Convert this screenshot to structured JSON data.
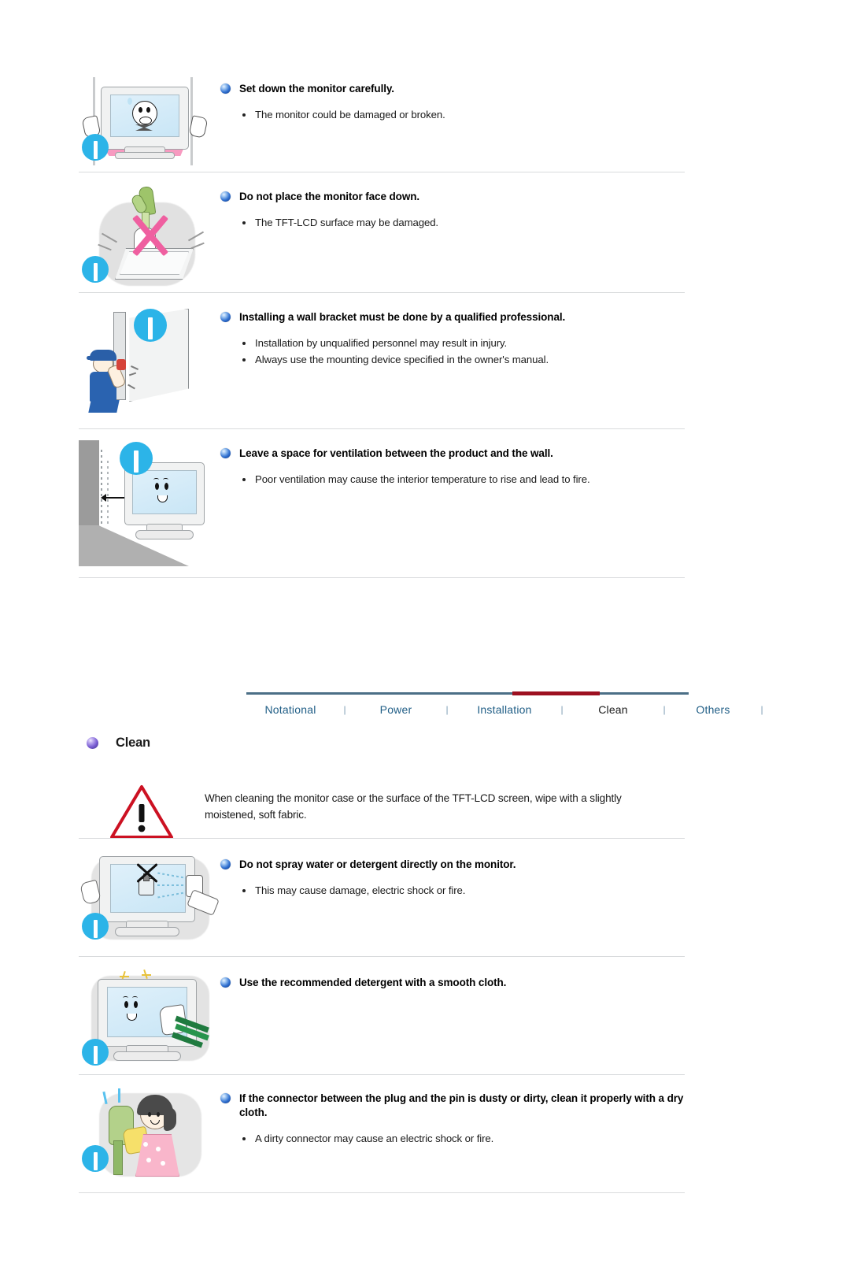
{
  "document": {
    "type": "monitor-safety-instructions-manual-page"
  },
  "sections": {
    "installation_items": [
      {
        "icon": "monitor-being-set-down-illustration",
        "badge": "blue-exclamation-icon",
        "title": "Set down the monitor carefully.",
        "bullets": [
          "The monitor could be damaged or broken."
        ]
      },
      {
        "icon": "monitor-face-down-crossed-out-illustration",
        "badge": "blue-exclamation-icon",
        "title": "Do not place the monitor face down.",
        "bullets": [
          "The TFT-LCD surface may be damaged."
        ]
      },
      {
        "icon": "technician-installing-wall-bracket-illustration",
        "badge": "blue-exclamation-icon",
        "title": "Installing a wall bracket must be done by a qualified professional.",
        "bullets": [
          "Installation by unqualified personnel may result in injury.",
          "Always use the mounting device specified in the owner's manual."
        ]
      },
      {
        "icon": "monitor-spaced-from-wall-illustration",
        "badge": "blue-exclamation-icon",
        "title": "Leave a space for ventilation between the product and the wall.",
        "bullets": [
          "Poor ventilation may cause the interior temperature to rise and lead to fire."
        ]
      }
    ]
  },
  "tabbar": {
    "tabs": [
      {
        "label": "Notational",
        "active": false
      },
      {
        "label": "Power",
        "active": false
      },
      {
        "label": "Installation",
        "active": false
      },
      {
        "label": "Clean",
        "active": true
      },
      {
        "label": "Others",
        "active": false
      }
    ],
    "separator": "|",
    "active_color": "#9d1020",
    "link_color": "#205e86",
    "rule_color": "#4b6f86"
  },
  "clean_section": {
    "heading": "Clean",
    "heading_bullet": "purple-sphere-icon",
    "warning": {
      "icon": "red-warning-triangle-icon",
      "text": "When cleaning the monitor case or the surface of the TFT-LCD screen, wipe with a slightly moistened, soft fabric."
    },
    "items": [
      {
        "icon": "spray-bottle-on-monitor-crossed-out-illustration",
        "badge": "blue-exclamation-icon",
        "title": "Do not spray water or detergent directly on the monitor.",
        "bullets": [
          "This may cause damage, electric shock or fire."
        ]
      },
      {
        "icon": "monitor-wiped-with-cloth-illustration",
        "badge": "blue-exclamation-icon",
        "title": "Use the recommended detergent with a smooth cloth.",
        "bullets": []
      },
      {
        "icon": "person-cleaning-plug-connector-illustration",
        "badge": "blue-exclamation-icon",
        "title": "If the connector between the plug and the pin is dusty or dirty, clean it properly with a dry cloth.",
        "bullets": [
          "A dirty connector may cause an electric shock or fire."
        ]
      }
    ]
  },
  "colors": {
    "badge_blue": "#2cb4e8",
    "bullet_blue": "#2f6fd0",
    "warning_red": "#cc1122",
    "divider": "#d9dbdd"
  }
}
